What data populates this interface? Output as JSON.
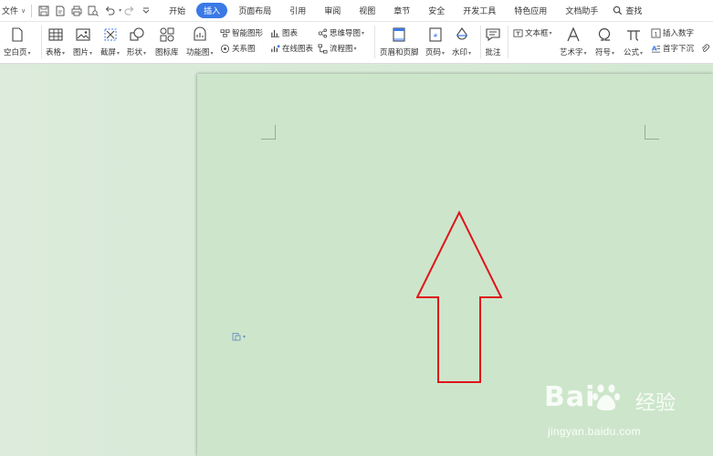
{
  "menubar": {
    "file_label": "文件",
    "tabs": [
      {
        "label": "开始",
        "active": false
      },
      {
        "label": "插入",
        "active": true
      },
      {
        "label": "页面布局",
        "active": false
      },
      {
        "label": "引用",
        "active": false
      },
      {
        "label": "审阅",
        "active": false
      },
      {
        "label": "视图",
        "active": false
      },
      {
        "label": "章节",
        "active": false
      },
      {
        "label": "安全",
        "active": false
      },
      {
        "label": "开发工具",
        "active": false
      },
      {
        "label": "特色应用",
        "active": false
      },
      {
        "label": "文档助手",
        "active": false
      }
    ],
    "search_label": "查找",
    "accent_color": "#3a79e6"
  },
  "ribbon": {
    "blank_page": "空白页",
    "table": "表格",
    "picture": "图片",
    "screenshot": "截屏",
    "shape": "形状",
    "icon_lib": "图标库",
    "function_chart": "功能图",
    "smart_shape": "智能图形",
    "relation_chart": "关系图",
    "chart": "图表",
    "online_chart": "在线图表",
    "mind_map": "思维导图",
    "flow_chart": "流程图",
    "header_footer": "页眉和页脚",
    "page_number": "页码",
    "watermark": "水印",
    "comment": "批注",
    "text_box": "文本框",
    "art_text": "艺术字",
    "symbol": "符号",
    "formula": "公式",
    "insert_number": "插入数字",
    "drop_cap": "首字下沉"
  },
  "document": {
    "shape_type": "up-arrow",
    "shape_stroke_color": "#e0141c",
    "page_color": "#cde6cb"
  },
  "watermark": {
    "brand": "Bai",
    "brand_cn": "经验",
    "url": "jingyan.baidu.com"
  }
}
